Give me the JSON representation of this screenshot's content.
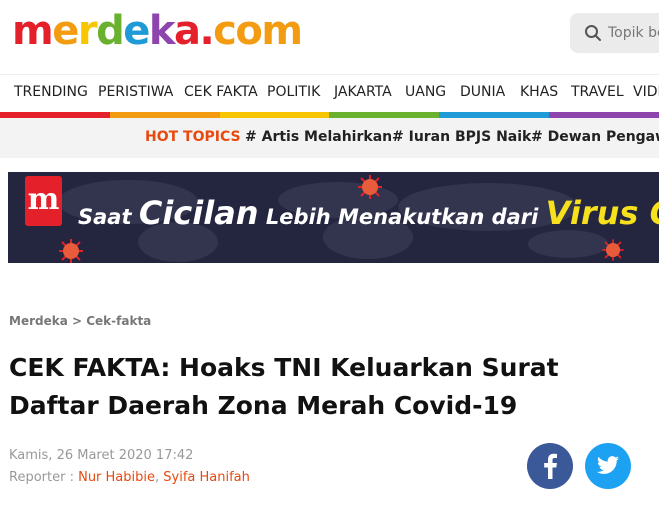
{
  "logo": {
    "letters": [
      {
        "ch": "m",
        "color": "#e4202b"
      },
      {
        "ch": "e",
        "color": "#f39c12"
      },
      {
        "ch": "r",
        "color": "#f7c600"
      },
      {
        "ch": "d",
        "color": "#6bb130"
      },
      {
        "ch": "e",
        "color": "#1e9ad6"
      },
      {
        "ch": "k",
        "color": "#8e44ad"
      },
      {
        "ch": "a",
        "color": "#e4202b"
      },
      {
        "ch": ".",
        "color": "#e4202b"
      },
      {
        "ch": "c",
        "color": "#f39c12"
      },
      {
        "ch": "o",
        "color": "#f39c12"
      },
      {
        "ch": "m",
        "color": "#f39c12"
      }
    ]
  },
  "search": {
    "placeholder": "Topik be",
    "icon": "search-icon"
  },
  "nav": {
    "items": [
      "TRENDING",
      "PERISTIWA",
      "CEK FAKTA",
      "POLITIK",
      "JAKARTA",
      "UANG",
      "DUNIA",
      "KHAS",
      "TRAVEL",
      "VIDE"
    ]
  },
  "rainbow_colors": [
    "#e4202b",
    "#f39c12",
    "#f7c600",
    "#6bb130",
    "#1e9ad6",
    "#8e44ad"
  ],
  "hot_topics": {
    "label": "HOT TOPICS",
    "items": [
      "# Artis Melahirkan",
      "# Iuran BPJS Naik",
      "# Dewan Pengawa"
    ]
  },
  "banner": {
    "logo_letter": "m",
    "part1": "Saat ",
    "part2": "Cicilan",
    "part3": " Lebih Menakutkan dari ",
    "part4": "Virus Co"
  },
  "article": {
    "breadcrumb_home": "Merdeka",
    "breadcrumb_sep": " > ",
    "breadcrumb_section": "Cek-fakta",
    "title": "CEK FAKTA: Hoaks TNI Keluarkan Surat Daftar Daerah Zona Merah Covid-19",
    "date": "Kamis, 26 Maret 2020 17:42",
    "reporter_label": "Reporter : ",
    "reporter_1": "Nur Habibie",
    "reporter_sep": ", ",
    "reporter_2": "Syifa Hanifah"
  },
  "social": {
    "facebook_color": "#3b5998",
    "twitter_color": "#1da1f2"
  }
}
